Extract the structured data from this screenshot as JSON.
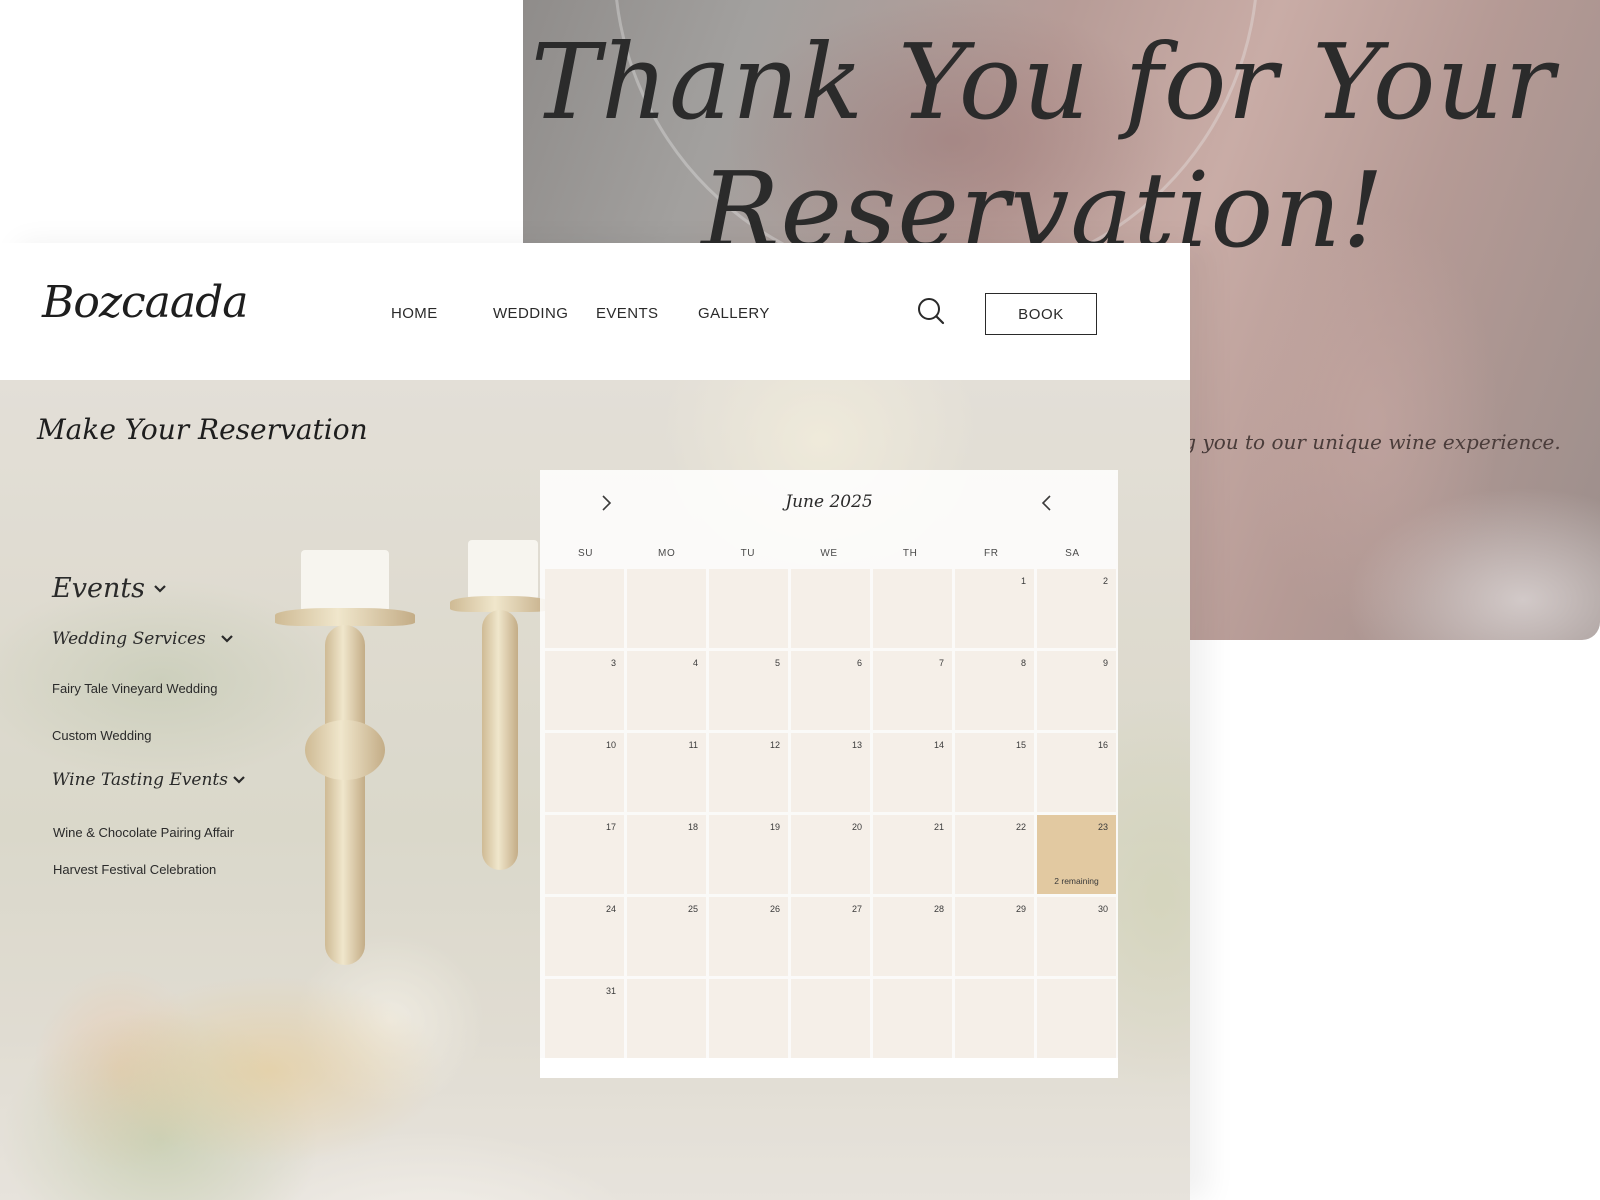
{
  "thank_you": {
    "title_line1": "Thank You for Your",
    "title_line2": "Reservation!",
    "subtitle": "ing you to our unique wine experience."
  },
  "header": {
    "logo": "Bozcaada",
    "nav": [
      "HOME",
      "WEDDING",
      "EVENTS",
      "GALLERY"
    ],
    "search_icon": "search-icon",
    "book_label": "BOOK"
  },
  "reservation": {
    "title": "Make Your Reservation",
    "menu": {
      "events_label": "Events",
      "wedding_services_label": "Wedding Services",
      "wedding_items": [
        "Fairy Tale Vineyard Wedding",
        "Custom Wedding"
      ],
      "wine_tasting_label": "Wine Tasting Events",
      "wine_items": [
        "Wine & Chocolate Pairing Affair",
        "Harvest Festival Celebration"
      ]
    }
  },
  "calendar": {
    "month_label": "June 2025",
    "prev_icon": "chevron-right-icon",
    "next_icon": "chevron-left-icon",
    "weekdays": [
      "SU",
      "MO",
      "TU",
      "WE",
      "TH",
      "FR",
      "SA"
    ],
    "first_weekday_index": 5,
    "days_in_month": 31,
    "highlight": {
      "day": 23,
      "note": "2 remaining"
    },
    "colors": {
      "cell": "#f5efe8",
      "highlight": "#e2c9a1"
    }
  }
}
